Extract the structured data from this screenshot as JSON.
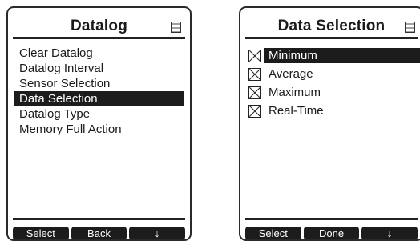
{
  "left_screen": {
    "title": "Datalog",
    "title_icon": "document-icon",
    "menu_items": [
      {
        "label": "Clear Datalog",
        "selected": false
      },
      {
        "label": "Datalog Interval",
        "selected": false
      },
      {
        "label": "Sensor Selection",
        "selected": false
      },
      {
        "label": "Data Selection",
        "selected": true
      },
      {
        "label": "Datalog Type",
        "selected": false
      },
      {
        "label": "Memory Full Action",
        "selected": false
      }
    ],
    "softkeys": {
      "select": "Select",
      "back": "Back",
      "down": "↓"
    }
  },
  "right_screen": {
    "title": "Data Selection",
    "title_icon": "document-icon",
    "options": [
      {
        "label": "Minimum",
        "checked": true,
        "selected": true
      },
      {
        "label": "Average",
        "checked": true,
        "selected": false
      },
      {
        "label": "Maximum",
        "checked": true,
        "selected": false
      },
      {
        "label": "Real-Time",
        "checked": true,
        "selected": false
      }
    ],
    "softkeys": {
      "select": "Select",
      "done": "Done",
      "down": "↓"
    }
  },
  "colors": {
    "highlight": "#1c1c1c",
    "highlight_text": "#ffffff",
    "frame": "#2a2a2a"
  }
}
